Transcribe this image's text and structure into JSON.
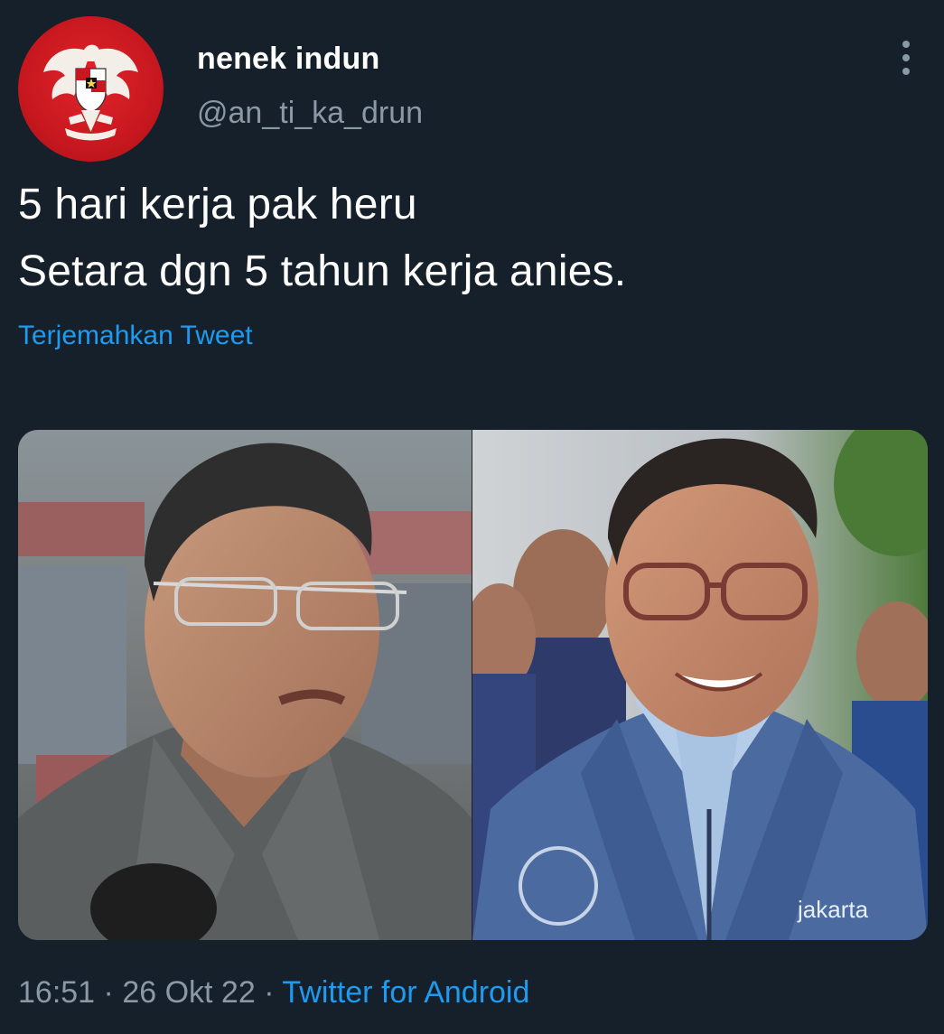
{
  "author": {
    "display_name": "nenek indun",
    "handle": "@an_ti_ka_drun",
    "avatar_icon": "garuda-pancasila-emblem-icon"
  },
  "tweet": {
    "lines": [
      "5 hari kerja pak heru",
      "Setara dgn 5 tahun kerja anies."
    ],
    "translate_label": "Terjemahkan Tweet"
  },
  "media": {
    "jacket_text": "jakarta"
  },
  "meta": {
    "time": "16:51",
    "separator": "·",
    "date": "26 Okt 22",
    "source": "Twitter for Android"
  },
  "colors": {
    "background": "#15202b",
    "text_primary": "#ffffff",
    "text_secondary": "#8b98a5",
    "link": "#1d9bf0",
    "avatar_red": "#c8181f"
  }
}
